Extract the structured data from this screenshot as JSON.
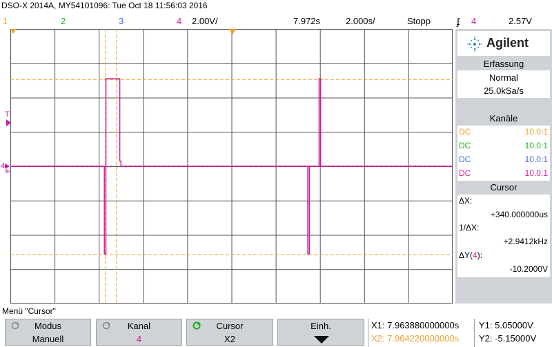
{
  "header": {
    "title": "DSO-X 2014A, MY54101096: Tue Oct 18 11:56:03 2016"
  },
  "channel_row": {
    "ch1": "1",
    "ch2": "2",
    "ch3": "3",
    "ch4": "4",
    "scale": "2.00V/",
    "time": "7.972s",
    "timebase": "2.000s/",
    "run_state": "Stopp",
    "trig_channel": "4",
    "trig_level": "2.57V"
  },
  "markers": {
    "trigger": "T",
    "ch4_ground": "4"
  },
  "brand": "Agilent",
  "acquisition": {
    "heading": "Erfassung",
    "mode": "Normal",
    "rate": "25.0kSa/s"
  },
  "channels": {
    "heading": "Kanäle",
    "rows": [
      {
        "coupling": "DC",
        "probe": "10.0:1",
        "color": "#f0a030"
      },
      {
        "coupling": "DC",
        "probe": "10.0:1",
        "color": "#1ab01a"
      },
      {
        "coupling": "DC",
        "probe": "10.0:1",
        "color": "#3a6fe0"
      },
      {
        "coupling": "DC",
        "probe": "10.0:1",
        "color": "#d01e9e"
      }
    ]
  },
  "cursor_panel": {
    "heading": "Cursor",
    "dx_label": "ΔX:",
    "dx_value": "+340.000000us",
    "inv_dx_label": "1/ΔX:",
    "inv_dx_value": "+2.9412kHz",
    "dy_label_prefix": "ΔY(",
    "dy_channel": "4",
    "dy_label_suffix": "):",
    "dy_value": "-10.2000V"
  },
  "menu": {
    "label": "Menü \"Cursor\""
  },
  "softkeys": [
    {
      "title": "Modus",
      "value": "Manuell"
    },
    {
      "title": "Kanal",
      "value": "4"
    },
    {
      "title": "Cursor",
      "value": "X2"
    },
    {
      "title": "Einh.",
      "value": ""
    }
  ],
  "readout": {
    "x1": "X1: 7.963880000000s",
    "y1": "Y1: 5.05000V",
    "x2": "X2: 7.964220000000s",
    "y2": "Y2: -5.15000V"
  },
  "colors": {
    "ch1": "#f0a030",
    "ch2": "#1ab01a",
    "ch3": "#3a6fe0",
    "ch4": "#d01e9e",
    "grid": "#555555",
    "cursor_x": "#f0a030",
    "cursor_y": "#f0a030"
  },
  "chart_data": {
    "type": "line",
    "series": [
      {
        "channel": "4",
        "description_of_shape": "",
        "x_divs": [
          0,
          4.25,
          4.25,
          4.32,
          4.32,
          4.95,
          4.95,
          5.0,
          5.0,
          13.45,
          13.45,
          13.52,
          13.52,
          13.96,
          13.96,
          14.03,
          14.03,
          20
        ],
        "y_divs": [
          0,
          0,
          -2.55,
          -2.55,
          2.55,
          2.55,
          0.15,
          0.15,
          0,
          0,
          -2.55,
          -2.55,
          0,
          0,
          2.55,
          2.55,
          0,
          0
        ]
      }
    ],
    "cursors": {
      "x1_div": 4.3,
      "x2_div": 4.8,
      "y1_div": 2.52,
      "y2_div": -2.57
    },
    "grid": true
  }
}
